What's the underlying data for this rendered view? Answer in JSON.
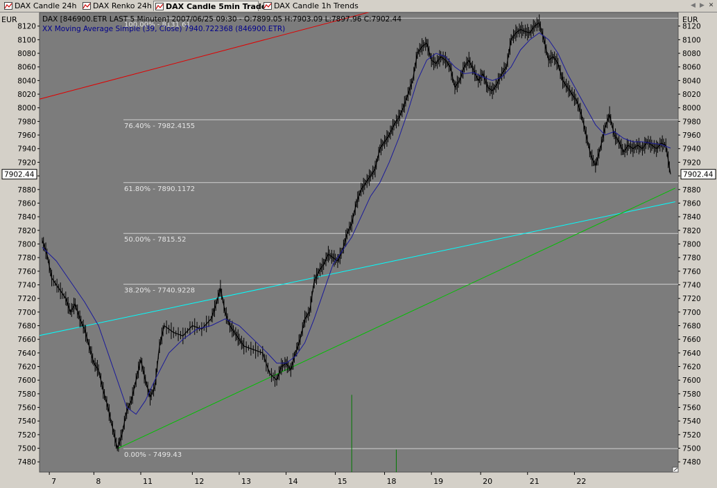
{
  "tabs": [
    {
      "label": "DAX Candle 24h",
      "active": false
    },
    {
      "label": "DAX Renko 24h",
      "active": false
    },
    {
      "label": "DAX Candle 5min Trade",
      "active": true
    },
    {
      "label": "DAX Candle 1h Trends",
      "active": false
    }
  ],
  "nav_icons": [
    "scroll-left-icon",
    "scroll-right-icon",
    "close-icon"
  ],
  "colors": {
    "plot_background": "#7c7c7c",
    "frame_background": "#d4d0c8",
    "price_bars": "#000000",
    "moving_average": "#1a1a9a",
    "fib_lines": "#d0d0d0",
    "red_trendline": "#e00000",
    "cyan_trendline": "#00ffff",
    "green_trendline": "#00c000",
    "volume": "#007a00"
  },
  "chart_data": {
    "type": "line",
    "currency": "EUR",
    "header_text": "DAX [846900.ETR LAST 5 Minuten] 2007/06/25 09:30 - O:7899.05 H:7903.09 L:7897.96 C:7902.44",
    "indicator_text": "XX Moving Average Simple (39, Close) 7940.722368 (846900.ETR)",
    "last_price_label": "7902.44",
    "last_price": 7902.44,
    "ylim": [
      7465,
      8140
    ],
    "y_ticks": [
      7480,
      7500,
      7520,
      7540,
      7560,
      7580,
      7600,
      7620,
      7640,
      7660,
      7680,
      7700,
      7720,
      7740,
      7760,
      7780,
      7800,
      7820,
      7840,
      7860,
      7880,
      7900,
      7920,
      7940,
      7960,
      7980,
      8000,
      8020,
      8040,
      8060,
      8080,
      8100,
      8120
    ],
    "x_day_labels": [
      "7",
      "8",
      "11",
      "12",
      "13",
      "14",
      "15",
      "18",
      "19",
      "20",
      "21",
      "22"
    ],
    "fibonacci": [
      {
        "label": "100.00% - 8131.61",
        "value": 8131.61
      },
      {
        "label": "76.40% - 7982.4155",
        "value": 7982.4155
      },
      {
        "label": "61.80% - 7890.1172",
        "value": 7890.1172
      },
      {
        "label": "50.00% - 7815.52",
        "value": 7815.52
      },
      {
        "label": "38.20% - 7740.9228",
        "value": 7740.9228
      },
      {
        "label": "0.00% - 7499.43",
        "value": 7499.43
      }
    ],
    "price_series": [
      [
        0.0,
        7805
      ],
      [
        0.1,
        7785
      ],
      [
        0.2,
        7750
      ],
      [
        0.35,
        7735
      ],
      [
        0.5,
        7720
      ],
      [
        0.6,
        7700
      ],
      [
        0.7,
        7712
      ],
      [
        0.8,
        7690
      ],
      [
        0.9,
        7675
      ],
      [
        1.0,
        7650
      ],
      [
        1.1,
        7625
      ],
      [
        1.2,
        7615
      ],
      [
        1.3,
        7585
      ],
      [
        1.4,
        7560
      ],
      [
        1.5,
        7530
      ],
      [
        1.6,
        7500
      ],
      [
        1.7,
        7520
      ],
      [
        1.8,
        7555
      ],
      [
        1.9,
        7570
      ],
      [
        2.0,
        7600
      ],
      [
        2.1,
        7630
      ],
      [
        2.2,
        7600
      ],
      [
        2.3,
        7575
      ],
      [
        2.4,
        7590
      ],
      [
        2.5,
        7650
      ],
      [
        2.6,
        7680
      ],
      [
        2.8,
        7670
      ],
      [
        3.0,
        7665
      ],
      [
        3.2,
        7680
      ],
      [
        3.4,
        7675
      ],
      [
        3.6,
        7690
      ],
      [
        3.7,
        7710
      ],
      [
        3.8,
        7735
      ],
      [
        3.9,
        7700
      ],
      [
        4.0,
        7680
      ],
      [
        4.1,
        7670
      ],
      [
        4.2,
        7660
      ],
      [
        4.3,
        7650
      ],
      [
        4.5,
        7645
      ],
      [
        4.7,
        7640
      ],
      [
        4.85,
        7610
      ],
      [
        5.0,
        7600
      ],
      [
        5.1,
        7620
      ],
      [
        5.2,
        7625
      ],
      [
        5.3,
        7615
      ],
      [
        5.4,
        7640
      ],
      [
        5.5,
        7660
      ],
      [
        5.6,
        7690
      ],
      [
        5.7,
        7700
      ],
      [
        5.8,
        7745
      ],
      [
        5.9,
        7760
      ],
      [
        6.0,
        7770
      ],
      [
        6.1,
        7785
      ],
      [
        6.2,
        7780
      ],
      [
        6.3,
        7775
      ],
      [
        6.4,
        7790
      ],
      [
        6.5,
        7815
      ],
      [
        6.6,
        7830
      ],
      [
        6.7,
        7860
      ],
      [
        6.8,
        7880
      ],
      [
        6.9,
        7890
      ],
      [
        7.0,
        7900
      ],
      [
        7.1,
        7910
      ],
      [
        7.2,
        7940
      ],
      [
        7.3,
        7950
      ],
      [
        7.4,
        7960
      ],
      [
        7.5,
        7975
      ],
      [
        7.6,
        7985
      ],
      [
        7.7,
        8000
      ],
      [
        7.8,
        8020
      ],
      [
        7.9,
        8040
      ],
      [
        8.0,
        8080
      ],
      [
        8.1,
        8090
      ],
      [
        8.2,
        8095
      ],
      [
        8.3,
        8070
      ],
      [
        8.4,
        8065
      ],
      [
        8.5,
        8075
      ],
      [
        8.6,
        8070
      ],
      [
        8.7,
        8060
      ],
      [
        8.8,
        8030
      ],
      [
        8.9,
        8040
      ],
      [
        9.0,
        8060
      ],
      [
        9.1,
        8070
      ],
      [
        9.2,
        8055
      ],
      [
        9.3,
        8040
      ],
      [
        9.4,
        8050
      ],
      [
        9.5,
        8030
      ],
      [
        9.6,
        8025
      ],
      [
        9.7,
        8035
      ],
      [
        9.8,
        8050
      ],
      [
        9.9,
        8060
      ],
      [
        10.0,
        8100
      ],
      [
        10.1,
        8110
      ],
      [
        10.2,
        8115
      ],
      [
        10.3,
        8112
      ],
      [
        10.4,
        8110
      ],
      [
        10.5,
        8120
      ],
      [
        10.6,
        8125
      ],
      [
        10.7,
        8100
      ],
      [
        10.8,
        8070
      ],
      [
        10.9,
        8075
      ],
      [
        11.0,
        8065
      ],
      [
        11.1,
        8040
      ],
      [
        11.2,
        8030
      ],
      [
        11.3,
        8020
      ],
      [
        11.4,
        8010
      ],
      [
        11.5,
        7990
      ],
      [
        11.6,
        7960
      ],
      [
        11.7,
        7930
      ],
      [
        11.8,
        7915
      ],
      [
        11.9,
        7940
      ],
      [
        12.0,
        7970
      ],
      [
        12.1,
        7990
      ],
      [
        12.2,
        7960
      ],
      [
        12.3,
        7950
      ],
      [
        12.4,
        7935
      ],
      [
        12.5,
        7945
      ],
      [
        12.6,
        7940
      ],
      [
        12.7,
        7945
      ],
      [
        12.8,
        7940
      ],
      [
        12.9,
        7950
      ],
      [
        13.0,
        7945
      ],
      [
        13.1,
        7940
      ],
      [
        13.2,
        7948
      ],
      [
        13.3,
        7945
      ],
      [
        13.4,
        7902.44
      ]
    ],
    "moving_average_series": [
      [
        0.0,
        7795
      ],
      [
        0.3,
        7775
      ],
      [
        0.6,
        7745
      ],
      [
        0.9,
        7715
      ],
      [
        1.2,
        7680
      ],
      [
        1.4,
        7640
      ],
      [
        1.6,
        7600
      ],
      [
        1.8,
        7560
      ],
      [
        2.0,
        7550
      ],
      [
        2.2,
        7570
      ],
      [
        2.4,
        7600
      ],
      [
        2.7,
        7640
      ],
      [
        3.0,
        7660
      ],
      [
        3.3,
        7675
      ],
      [
        3.6,
        7680
      ],
      [
        3.9,
        7690
      ],
      [
        4.2,
        7680
      ],
      [
        4.5,
        7660
      ],
      [
        4.8,
        7640
      ],
      [
        5.0,
        7625
      ],
      [
        5.2,
        7625
      ],
      [
        5.4,
        7635
      ],
      [
        5.6,
        7655
      ],
      [
        5.8,
        7690
      ],
      [
        6.0,
        7730
      ],
      [
        6.2,
        7770
      ],
      [
        6.4,
        7790
      ],
      [
        6.6,
        7810
      ],
      [
        6.8,
        7840
      ],
      [
        7.0,
        7870
      ],
      [
        7.2,
        7890
      ],
      [
        7.4,
        7920
      ],
      [
        7.6,
        7955
      ],
      [
        7.8,
        7995
      ],
      [
        8.0,
        8040
      ],
      [
        8.2,
        8070
      ],
      [
        8.4,
        8080
      ],
      [
        8.6,
        8075
      ],
      [
        8.8,
        8060
      ],
      [
        9.0,
        8050
      ],
      [
        9.2,
        8052
      ],
      [
        9.4,
        8045
      ],
      [
        9.6,
        8040
      ],
      [
        9.8,
        8045
      ],
      [
        10.0,
        8060
      ],
      [
        10.2,
        8085
      ],
      [
        10.4,
        8100
      ],
      [
        10.6,
        8110
      ],
      [
        10.8,
        8100
      ],
      [
        11.0,
        8080
      ],
      [
        11.2,
        8050
      ],
      [
        11.4,
        8025
      ],
      [
        11.6,
        8000
      ],
      [
        11.8,
        7975
      ],
      [
        12.0,
        7960
      ],
      [
        12.2,
        7965
      ],
      [
        12.4,
        7955
      ],
      [
        12.6,
        7950
      ],
      [
        12.8,
        7950
      ],
      [
        13.0,
        7948
      ],
      [
        13.2,
        7946
      ],
      [
        13.4,
        7940.72
      ]
    ],
    "trendlines": [
      {
        "name": "red",
        "points": [
          [
            -0.1,
            8012
          ],
          [
            7.5,
            8150
          ]
        ]
      },
      {
        "name": "cyan",
        "points": [
          [
            -0.1,
            7665
          ],
          [
            13.5,
            7862
          ]
        ]
      },
      {
        "name": "green",
        "points": [
          [
            1.6,
            7499.43
          ],
          [
            13.5,
            7882
          ]
        ]
      }
    ],
    "volume_spikes": [
      [
        6.6,
        0.62
      ],
      [
        7.55,
        0.18
      ]
    ]
  }
}
